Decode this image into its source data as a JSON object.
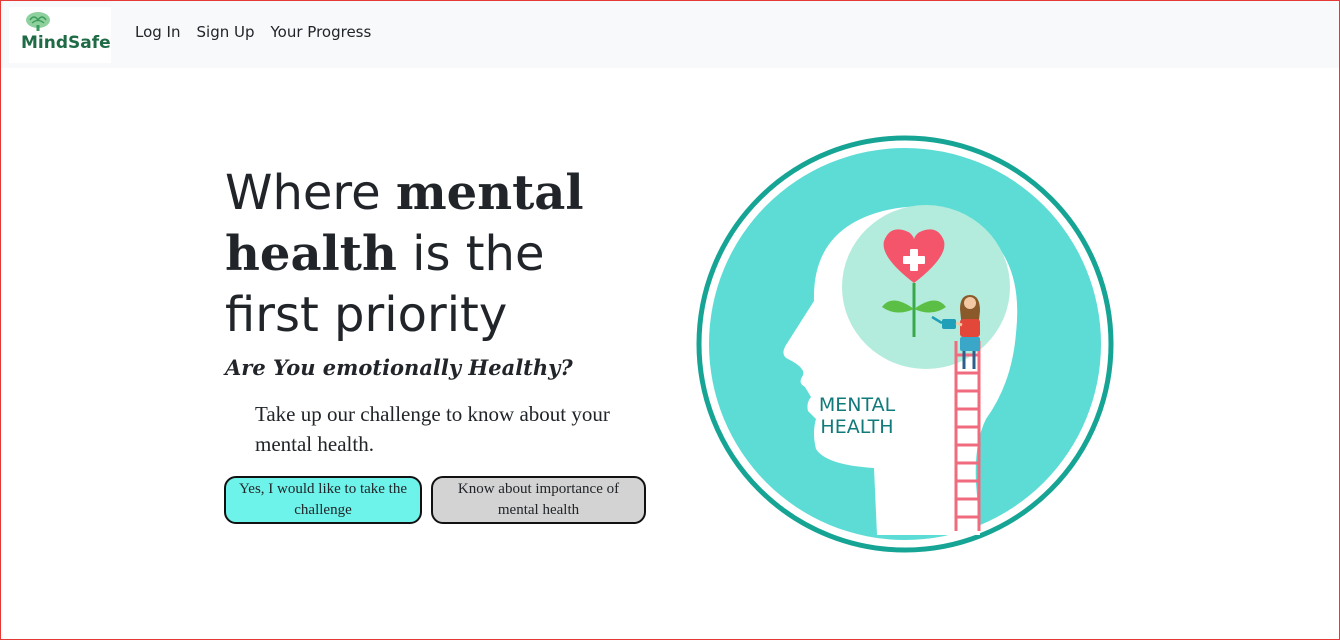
{
  "brand": {
    "name": "MindSafe"
  },
  "nav": {
    "links": [
      {
        "label": "Log In"
      },
      {
        "label": "Sign Up"
      },
      {
        "label": "Your Progress"
      }
    ]
  },
  "hero": {
    "headline_part1": "Where ",
    "headline_bold1": "mental",
    "headline_bold2": "health",
    "headline_part2": " is the",
    "headline_part3": "first priority",
    "subheading": "Are You emotionally Healthy?",
    "description": "Take up our challenge to know about your mental health.",
    "primary_button": "Yes, I would like to take the challenge",
    "secondary_button": "Know about importance of mental health"
  },
  "illustration": {
    "label_line1": "MENTAL",
    "label_line2": "HEALTH"
  },
  "colors": {
    "teal": "#5ddcd6",
    "ring": "#16a595",
    "mint": "#b3ecdc",
    "heart": "#f5556b",
    "primary_button": "#6ef3ea",
    "secondary_button": "#d3d3d3",
    "brand_green": "#1f6b45"
  }
}
